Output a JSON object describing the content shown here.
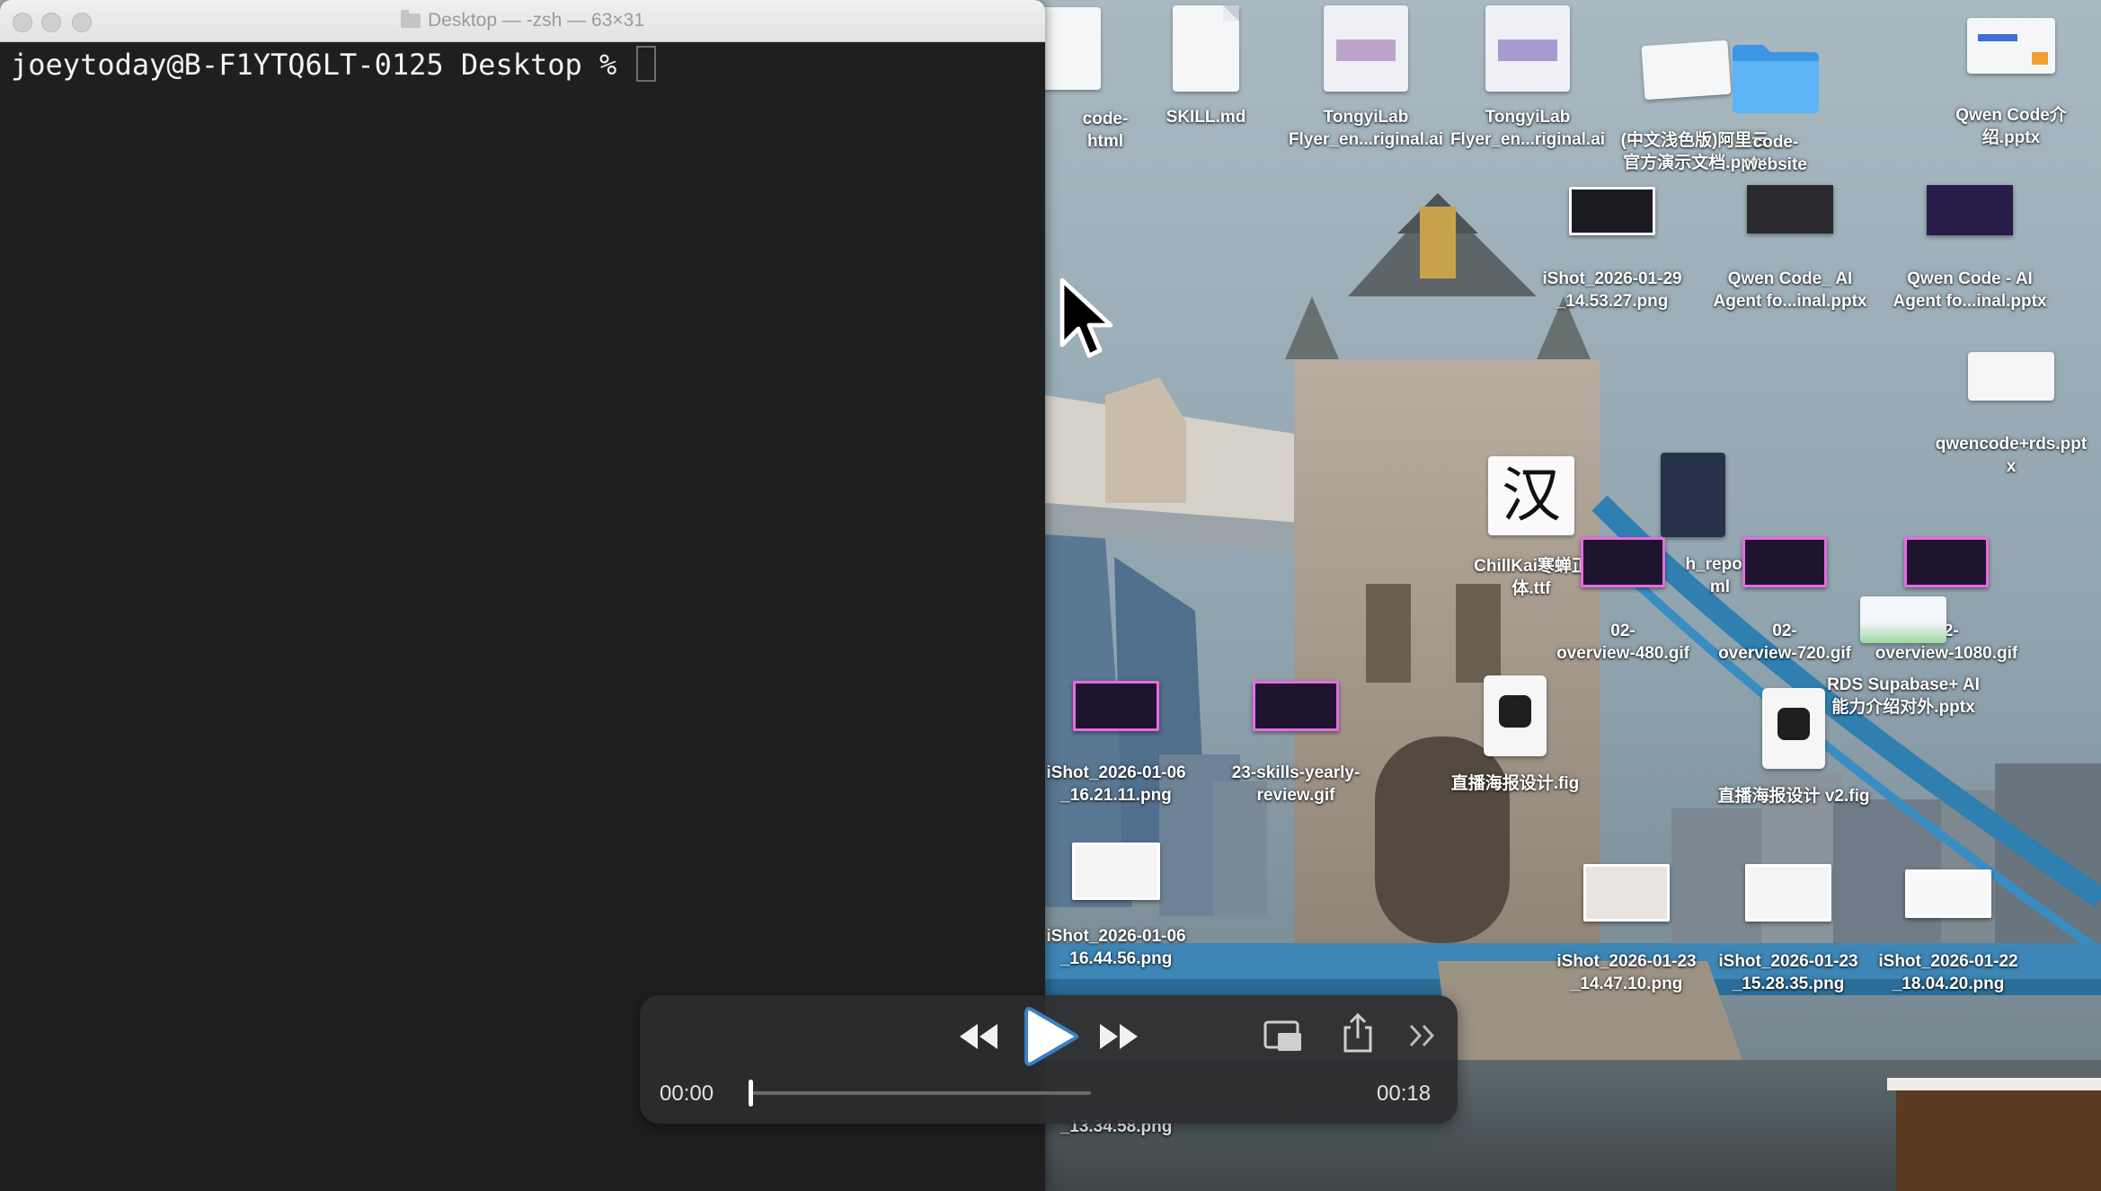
{
  "terminal": {
    "title": "Desktop — -zsh — 63×31",
    "prompt": "joeytoday@B-F1YTQ6LT-0125 Desktop % "
  },
  "desktop_icons": [
    {
      "label": "code-\nhtml"
    },
    {
      "label": "SKILL.md"
    },
    {
      "label": "TongyiLab\nFlyer_en...riginal.ai"
    },
    {
      "label": "TongyiLab\nFlyer_en...riginal.ai"
    },
    {
      "label": "(中文浅色版)阿里云\n官方演示文档.pptx"
    },
    {
      "label": "code-\nwebsite"
    },
    {
      "label": "Qwen Code介\n绍.pptx"
    },
    {
      "label": "iShot_2026-01-29\n_14.53.27.png"
    },
    {
      "label": "Qwen Code_ AI\nAgent fo...inal.pptx"
    },
    {
      "label": "Qwen Code - AI\nAgent fo...inal.pptx"
    },
    {
      "label": "qwencode+rds.ppt\nx"
    },
    {
      "label": "ChillKai寒蝉正\n体.ttf"
    },
    {
      "label": "h_report\nml"
    },
    {
      "label": "02-\noverview-480.gif"
    },
    {
      "label": "02-\noverview-720.gif"
    },
    {
      "label": "02-\noverview-1080.gif"
    },
    {
      "label": "RDS Supabase+ AI\n能力介绍对外.pptx"
    },
    {
      "label": "iShot_2026-01-06\n_16.21.11.png"
    },
    {
      "label": "23-skills-yearly-\nreview.gif"
    },
    {
      "label": "直播海报设计.fig"
    },
    {
      "label": "直播海报设计 v2.fig"
    },
    {
      "label": "iShot_2026-01-06\n_16.44.56.png"
    },
    {
      "label": "iShot_2026-01-23\n_14.47.10.png"
    },
    {
      "label": "iShot_2026-01-23\n_15.28.35.png"
    },
    {
      "label": "iShot_2026-01-22\n_18.04.20.png"
    },
    {
      "label": "_13.34.58.png"
    }
  ],
  "glyph_icon": "汉",
  "player": {
    "current_time": "00:00",
    "duration": "00:18",
    "progress": 0.0,
    "icons": [
      "rewind-icon",
      "play-icon",
      "fast-forward-icon",
      "picture-in-picture-icon",
      "share-icon",
      "more-icon"
    ]
  },
  "colors": {
    "terminal_bg": "#1f1f1f",
    "sky": "#8ea2ad",
    "player_bg": "#2c2c2e",
    "folder_blue": "#4aa3ef"
  }
}
